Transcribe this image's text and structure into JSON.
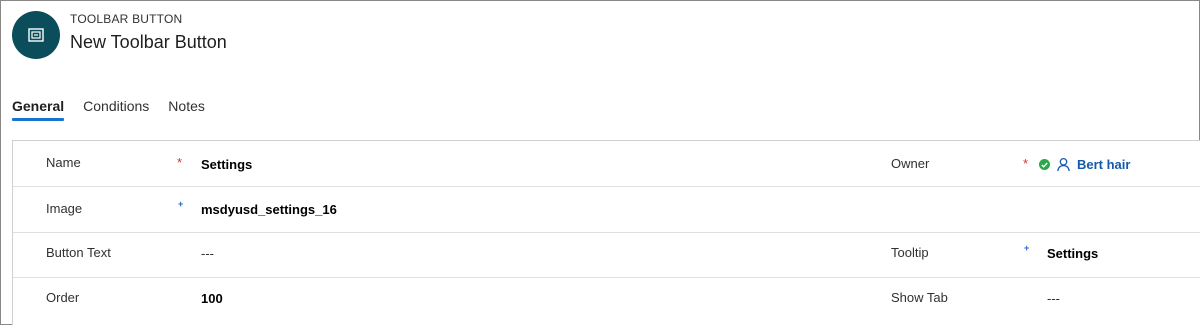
{
  "header": {
    "entity_type": "TOOLBAR BUTTON",
    "record_title": "New Toolbar Button",
    "avatar_icon": "toolbar-button-icon",
    "avatar_color": "#0b4d5b"
  },
  "tabs": [
    {
      "label": "General",
      "active": true
    },
    {
      "label": "Conditions",
      "active": false
    },
    {
      "label": "Notes",
      "active": false
    }
  ],
  "accent_color": "#1873cf",
  "fields": {
    "name": {
      "label": "Name",
      "required_marker": "*",
      "value": "Settings"
    },
    "image": {
      "label": "Image",
      "recommended_marker": "+",
      "value": "msdyusd_settings_16"
    },
    "button_text": {
      "label": "Button Text",
      "value": "---"
    },
    "order": {
      "label": "Order",
      "value": "100"
    },
    "owner": {
      "label": "Owner",
      "required_marker": "*",
      "value": "Bert hair",
      "status_icon": "check-circle-icon",
      "user_icon": "person-icon"
    },
    "tooltip": {
      "label": "Tooltip",
      "recommended_marker": "+",
      "value": "Settings"
    },
    "show_tab": {
      "label": "Show Tab",
      "value": "---"
    }
  }
}
